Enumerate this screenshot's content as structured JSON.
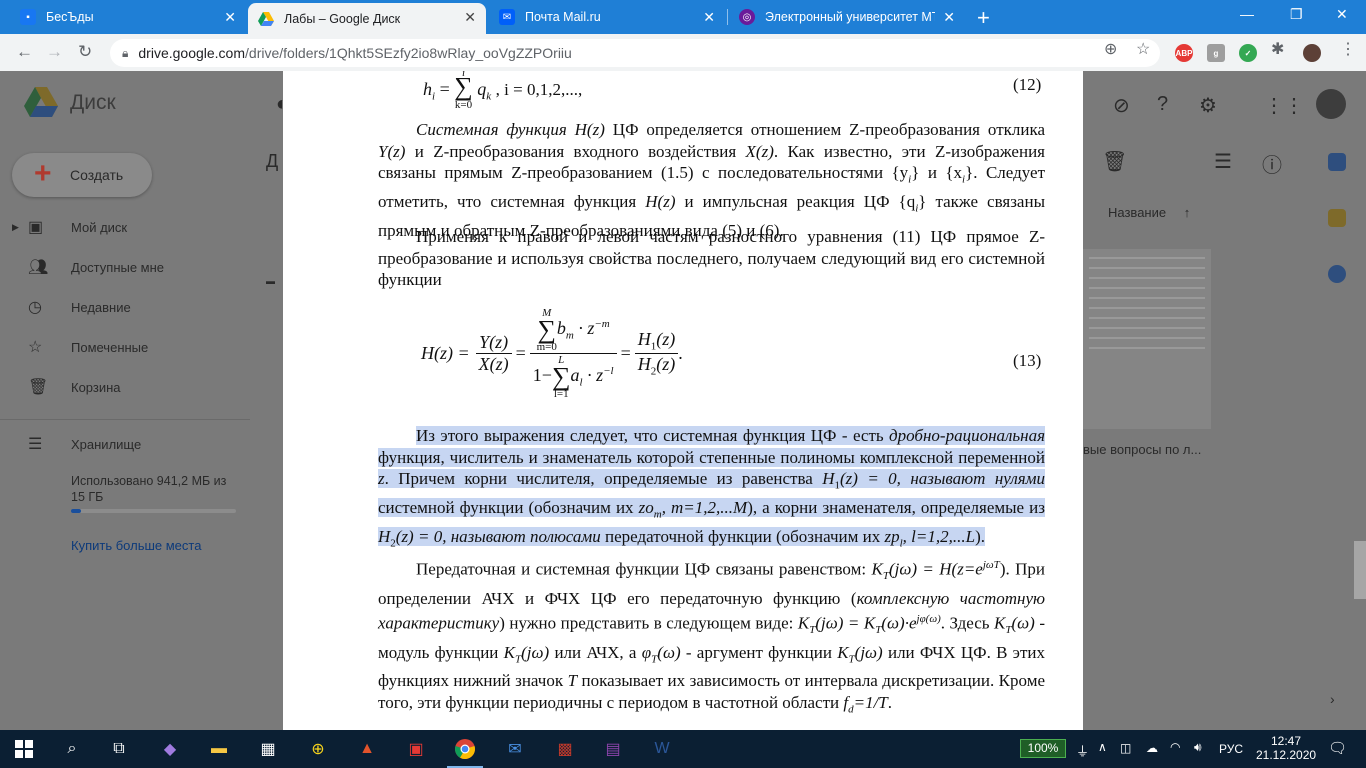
{
  "browser": {
    "tabs": [
      {
        "title": "БесЪды",
        "fav_color": "#1877f2",
        "active": false
      },
      {
        "title": "Лабы – Google Диск",
        "fav_color": "#fbbc04",
        "active": true
      },
      {
        "title": "Почта Mail.ru",
        "fav_color": "#005ff9",
        "active": false
      },
      {
        "title": "Электронный университет МТУ",
        "fav_color": "#6a1b9a",
        "active": false
      }
    ],
    "url_domain": "drive.google.com",
    "url_path": "/drive/folders/1Qhkt5SEzfy2io8wRlay_ooVgZZPOriiu",
    "ext_abp": "ABP"
  },
  "drive": {
    "app_name": "Диск",
    "create_label": "Создать",
    "nav": [
      {
        "label": "Мой диск",
        "icon": "drive-icon"
      },
      {
        "label": "Доступные мне",
        "icon": "people-icon"
      },
      {
        "label": "Недавние",
        "icon": "clock-icon"
      },
      {
        "label": "Помеченные",
        "icon": "star-icon"
      },
      {
        "label": "Корзина",
        "icon": "trash-icon"
      }
    ],
    "storage_label": "Хранилище",
    "storage_used": "Использовано 941,2 МБ из 15 ГБ",
    "storage_fraction": 0.06,
    "buy_more": "Купить больше места",
    "sort_label": "Название",
    "file_name_fragment": "вые вопросы по л...",
    "header_fragment": "Д"
  },
  "doc": {
    "f12_lhs": "h",
    "f12_sub": "i",
    "f12_rhs": "q",
    "f12_rhs_sub": "k",
    "f12_tail": ", i = 0,1,2,...,",
    "f12_sum_low": "k=0",
    "f12_sum_up": "i",
    "eq12": "(12)",
    "p1_a": "Системная функция",
    "p1_b": "H(z)",
    "p1_c": " ЦФ определяется отношением Z-преобразования отклика ",
    "p1_d": "Y(z)",
    "p1_e": " и Z-преобразования входного воздействия ",
    "p1_f": "X(z)",
    "p1_g": ". Как известно, эти Z-изображения связаны прямым Z-преобразованием (1.5) с последовательностями {y",
    "p1_h": "i",
    "p1_i": "} и {x",
    "p1_j": "i",
    "p1_k": "}. Следует отметить, что системная функция ",
    "p1_l": "H(z)",
    "p1_m": " и импульсная реакция ЦФ {q",
    "p1_n": "i",
    "p1_o": "} также связаны прямым и обратным Z-преобразованиями вида (5) и (6).",
    "p2": "Применяя к правой и левой частям разностного уравнения (11) ЦФ прямое Z-преобразование и используя свойства последнего, получаем следующий вид его системной функции",
    "f13_hz": "H(z) =",
    "f13_yz": "Y(z)",
    "f13_xz": "X(z)",
    "f13_num": "b",
    "f13_num_sub": "m",
    "f13_num_pow": " · z",
    "f13_num_exp": "−m",
    "f13_num_low": "m=0",
    "f13_num_up": "M",
    "f13_den_pre": "1−",
    "f13_den": "a",
    "f13_den_sub": "l",
    "f13_den_pow": " · z",
    "f13_den_exp": "−l",
    "f13_den_low": "l=1",
    "f13_den_up": "L",
    "f13_h1": "H",
    "f13_h1_sub": "1",
    "f13_h1_arg": "(z)",
    "f13_h2": "H",
    "f13_h2_sub": "2",
    "f13_h2_arg": "(z)",
    "eq13": "(13)",
    "p3_a": "Из этого выражения следует, что системная функция ЦФ - есть ",
    "p3_b": "дробно-рациональная",
    "p3_c": " функция, числитель и знаменатель которой степенные полиномы комплексной переменной ",
    "p3_d": "z",
    "p3_e": ". Причем корни числителя, определяемые из равенства ",
    "p3_f": "H",
    "p3_g": "1",
    "p3_h": "(z) = 0, называют ",
    "p3_i": "нулями",
    "p3_j": " системной функции (обозначим их ",
    "p3_k": "zo",
    "p3_l": "m",
    "p3_m": ", m=1,2,...M",
    "p3_n": "), а корни знаменателя, определяемые из ",
    "p3_o": "H",
    "p3_p": "2",
    "p3_q": "(z) = 0, называют ",
    "p3_r": "полюсами",
    "p3_s": " передаточной функции (обозначим их ",
    "p3_t": "zp",
    "p3_u": "l",
    "p3_v": ", l=1,2,...L",
    "p3_w": ").",
    "p4_a": "Передаточная и системная функции ЦФ связаны равенством: ",
    "p4_b": "K",
    "p4_c": "T",
    "p4_d": "(jω) = H(z=e",
    "p4_e": "jωT",
    "p4_f": "). При определении АЧХ и ФЧХ ЦФ его передаточную функцию (",
    "p4_g": "комплексную частотную характеристику",
    "p4_h": ") нужно представить в следующем виде: ",
    "p4_i": "K",
    "p4_j": "T",
    "p4_k": "(jω) = K",
    "p4_l": "T",
    "p4_m": "(ω)·e",
    "p4_n": "jφ(ω)",
    "p4_o": ". Здесь ",
    "p4_p": "K",
    "p4_q": "T",
    "p4_r": "(ω)",
    "p4_s": " - модуль функции ",
    "p4_t": "K",
    "p4_u": "T",
    "p4_v": "(jω)",
    "p4_w": " или АЧХ, а ",
    "p4_x": "φ",
    "p4_y": "T",
    "p4_z": "(ω)",
    "p4_aa": " - аргумент функции ",
    "p4_ab": "K",
    "p4_ac": "T",
    "p4_ad": "(jω)",
    "p4_ae": " или ФЧХ ЦФ. В этих функциях нижний значок ",
    "p4_af": "T",
    "p4_ag": " показывает их зависимость от интервала дискретизации. Кроме того, эти функции периодичны с периодом в частотной области ",
    "p4_ah": "f",
    "p4_ai": "d",
    "p4_aj": "=1/T",
    "p4_ak": "."
  },
  "taskbar": {
    "battery": "100%",
    "lang": "РУС",
    "time": "12:47",
    "date": "21.12.2020"
  }
}
